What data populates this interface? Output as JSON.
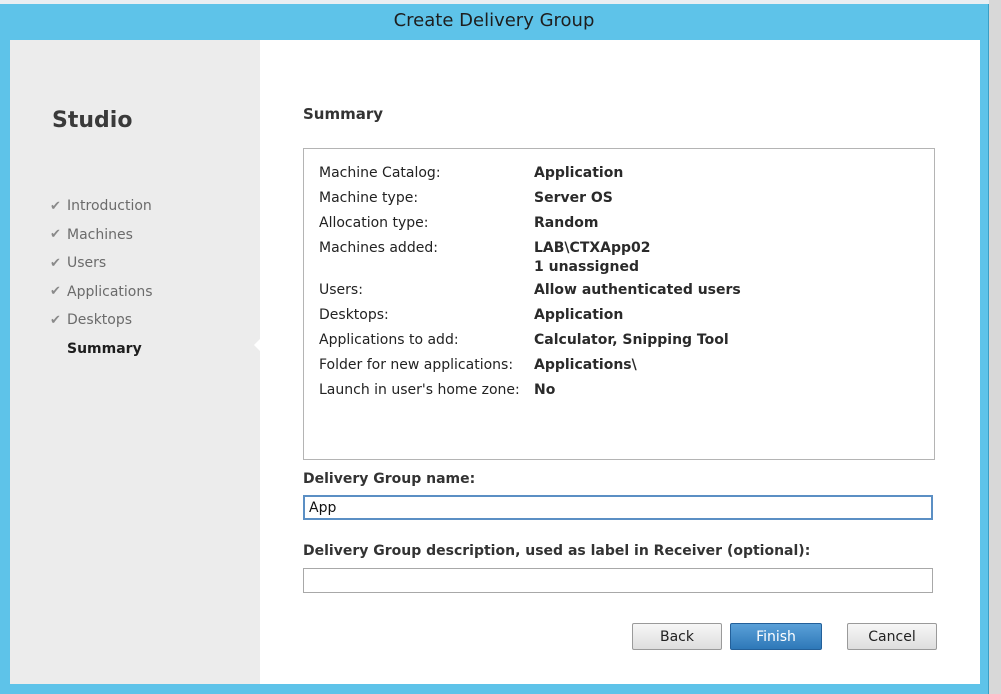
{
  "window": {
    "title": "Create Delivery Group"
  },
  "sidebar": {
    "title": "Studio",
    "items": [
      {
        "label": "Introduction",
        "completed": true
      },
      {
        "label": "Machines",
        "completed": true
      },
      {
        "label": "Users",
        "completed": true
      },
      {
        "label": "Applications",
        "completed": true
      },
      {
        "label": "Desktops",
        "completed": true
      },
      {
        "label": "Summary",
        "completed": false,
        "active": true
      }
    ],
    "check_glyph": "✔"
  },
  "main": {
    "section_title": "Summary",
    "summary": [
      {
        "key": "Machine Catalog:",
        "value": "Application"
      },
      {
        "key": "Machine type:",
        "value": "Server OS"
      },
      {
        "key": "Allocation type:",
        "value": "Random"
      },
      {
        "key": "Machines added:",
        "value": "LAB\\CTXApp02",
        "value2": "1 unassigned"
      },
      {
        "key": "Users:",
        "value": "Allow authenticated users"
      },
      {
        "key": "Desktops:",
        "value": "Application"
      },
      {
        "key": "Applications to add:",
        "value": "Calculator, Snipping Tool"
      },
      {
        "key": "Folder for new applications:",
        "value": "Applications\\"
      },
      {
        "key": "Launch in user's home zone:",
        "value": "No"
      }
    ],
    "name_label": "Delivery Group name:",
    "name_value": "App",
    "description_label": "Delivery Group description, used as label in Receiver (optional):",
    "description_value": ""
  },
  "buttons": {
    "back": "Back",
    "finish": "Finish",
    "cancel": "Cancel"
  },
  "colors": {
    "title_bar": "#5ec3e9",
    "primary_button": "#2e78b8"
  }
}
